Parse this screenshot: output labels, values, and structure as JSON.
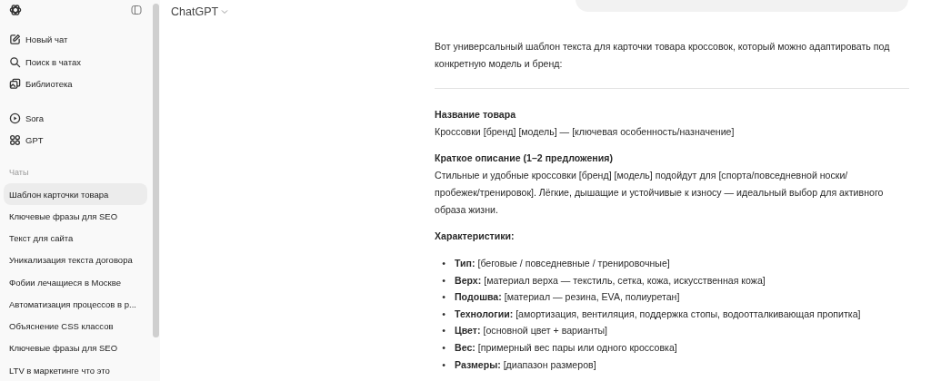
{
  "sidebar": {
    "nav_items": [
      {
        "label": "Новый чат"
      },
      {
        "label": "Поиск в чатах"
      },
      {
        "label": "Библиотека"
      }
    ],
    "tools": [
      {
        "label": "Sora"
      },
      {
        "label": "GPT"
      }
    ],
    "chats": {
      "heading": "Чаты",
      "items": [
        {
          "label": "Шаблон карточки товара",
          "selected": true
        },
        {
          "label": "Ключевые фразы для SEO",
          "selected": false
        },
        {
          "label": "Текст для сайта",
          "selected": false
        },
        {
          "label": "Уникализация текста договора",
          "selected": false
        },
        {
          "label": "Фобии лечащиеся в Москве",
          "selected": false
        },
        {
          "label": "Автоматизация процессов в р...",
          "selected": false
        },
        {
          "label": "Объяснение CSS классов",
          "selected": false
        },
        {
          "label": "Ключевые фразы для SEO",
          "selected": false
        },
        {
          "label": "LTV в маркетинге что это",
          "selected": false
        }
      ]
    }
  },
  "header": {
    "title": "ChatGPT"
  },
  "message": {
    "intro": "Вот универсальный шаблон текста для карточки товара кроссовок, который можно адаптировать под конкретную модель и бренд:",
    "sections": [
      {
        "heading": "Название товара",
        "text": "Кроссовки [бренд] [модель] — [ключевая особенность/назначение]"
      },
      {
        "heading": "Краткое описание (1–2 предложения)",
        "text": "Стильные и удобные кроссовки [бренд] [модель] подойдут для [спорта/повседневной носки/ пробежек/тренировок]. Лёгкие, дышащие и устойчивые к износу — идеальный выбор для активного образа жизни."
      }
    ],
    "characteristics": {
      "heading": "Характеристики:",
      "items": [
        {
          "marker": "•",
          "text": "**Тип:** [беговые / повседневные / тренировочные]"
        },
        {
          "marker": "•",
          "text": "**Верх:** [материал верха — текстиль, сетка, кожа, искусственная кожа]"
        },
        {
          "marker": "•",
          "text": "**Подошва:** [материал — резина, EVA, полиуретан]"
        },
        {
          "marker": "•",
          "text": "**Технологии:** [амортизация, вентиляция, поддержка стопы, водоотталкивающая пропитка]"
        },
        {
          "marker": "•",
          "text": "**Цвет:** [основной цвет + варианты]"
        },
        {
          "marker": "•",
          "text": "**Вес:** [примерный вес пары или одного кроссовка]"
        },
        {
          "marker": "•",
          "text": "**Размеры:** [диапазон размеров]"
        }
      ]
    }
  }
}
